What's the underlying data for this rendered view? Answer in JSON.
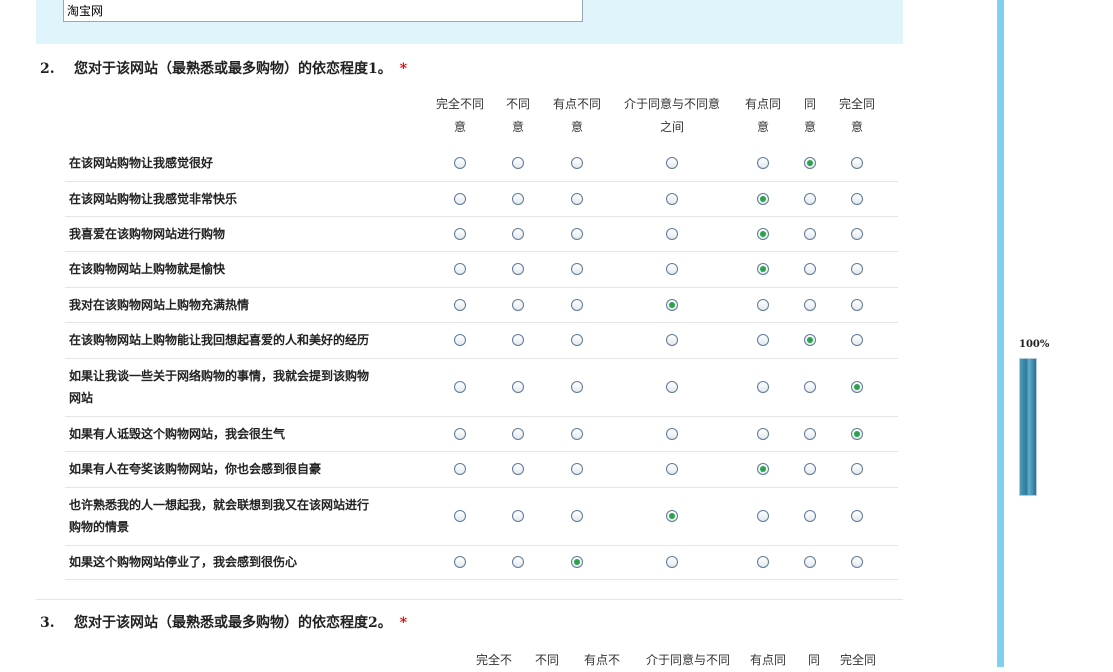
{
  "q1": {
    "answer": "淘宝网"
  },
  "q2": {
    "number": "2.",
    "title": "您对于该网站（最熟悉或最多购物）的依恋程度1。",
    "required_mark": "*",
    "options": [
      [
        "完全不同",
        "意"
      ],
      [
        "不同",
        "意"
      ],
      [
        "有点不同",
        "意"
      ],
      [
        "介于同意与不同意",
        "之间"
      ],
      [
        "有点同",
        "意"
      ],
      [
        "同",
        "意"
      ],
      [
        "完全同",
        "意"
      ]
    ],
    "rows": [
      {
        "label": [
          "在该网站购物让我感觉很好"
        ],
        "selected": 5
      },
      {
        "label": [
          "在该网站购物让我感觉非常快乐"
        ],
        "selected": 4
      },
      {
        "label": [
          "我喜爱在该购物网站进行购物"
        ],
        "selected": 4
      },
      {
        "label": [
          "在该购物网站上购物就是愉快"
        ],
        "selected": 4
      },
      {
        "label": [
          "我对在该购物网站上购物充满热情"
        ],
        "selected": 3
      },
      {
        "label": [
          "在该购物网站上购物能让我回想起喜爱的人和美好的经历"
        ],
        "selected": 5
      },
      {
        "label": [
          "如果让我谈一些关于网络购物的事情，我就会提到该购物",
          "网站"
        ],
        "selected": 6
      },
      {
        "label": [
          "如果有人诋毁这个购物网站，我会很生气"
        ],
        "selected": 6
      },
      {
        "label": [
          "如果有人在夸奖该购物网站，你也会感到很自豪"
        ],
        "selected": 4
      },
      {
        "label": [
          "也许熟悉我的人一想起我，就会联想到我又在该网站进行",
          "购物的情景"
        ],
        "selected": 3
      },
      {
        "label": [
          "如果这个购物网站停业了，我会感到很伤心"
        ],
        "selected": 2
      }
    ]
  },
  "q3": {
    "number": "3.",
    "title": "您对于该网站（最熟悉或最多购物）的依恋程度2。",
    "required_mark": "*",
    "options": [
      "完全不",
      "不同",
      "有点不",
      "介于同意与不同",
      "有点同",
      "同",
      "完全同"
    ]
  },
  "progress": {
    "label": "100%",
    "value": 1.0
  },
  "colors": {
    "accent": "#7fd0f1",
    "panel": "#dff4fb",
    "required": "#e00000",
    "radio_dot": "#2aa34a"
  }
}
